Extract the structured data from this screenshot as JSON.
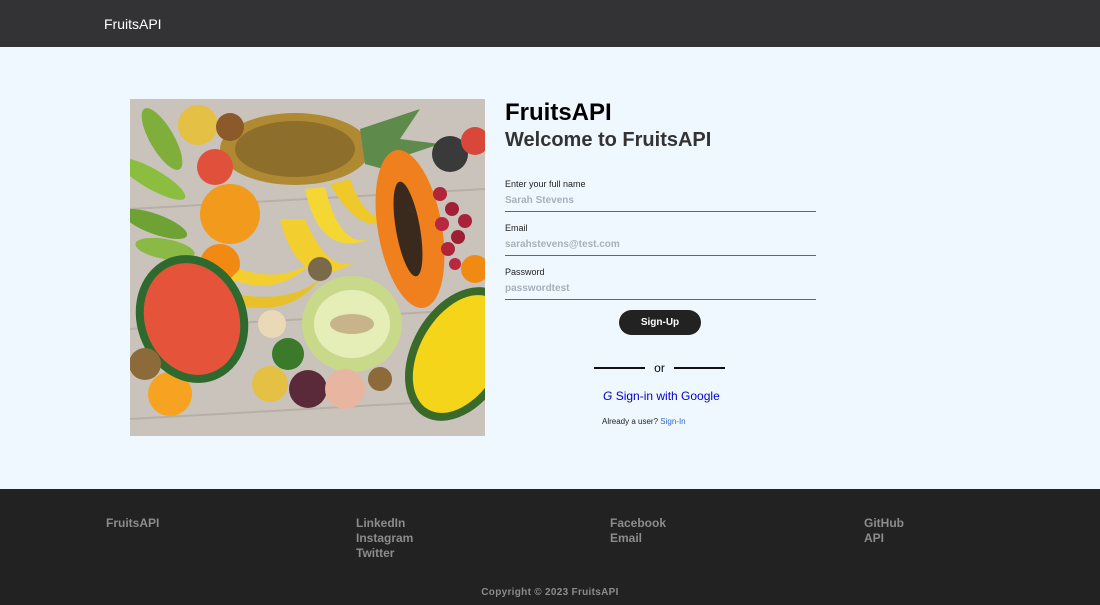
{
  "navbar": {
    "brand": "FruitsAPI"
  },
  "form": {
    "title": "FruitsAPI",
    "subtitle": "Welcome to FruitsAPI",
    "fields": [
      {
        "label": "Enter your full name",
        "value": "",
        "placeholder": "Sarah Stevens"
      },
      {
        "label": "Email",
        "value": "",
        "placeholder": "sarahstevens@test.com"
      },
      {
        "label": "Password",
        "value": "",
        "placeholder": "passwordtest"
      }
    ],
    "signup_label": "Sign-Up",
    "divider_text": "or",
    "google_icon": "G",
    "google_label": "Sign-in with Google",
    "already_user_text": "Already a user?",
    "signin_link": "Sign-In"
  },
  "hero": {
    "icon": "fruits-photo"
  },
  "footer": {
    "columns": [
      {
        "links": [
          "FruitsAPI"
        ]
      },
      {
        "links": [
          "LinkedIn",
          "Instagram",
          "Twitter"
        ]
      },
      {
        "links": [
          "Facebook",
          "Email"
        ]
      },
      {
        "links": [
          "GitHub",
          "API"
        ]
      }
    ],
    "copyright": "Copyright © 2023 FruitsAPI"
  },
  "colors": {
    "navbar_bg": "#333336",
    "page_bg": "#f0f8ff",
    "footer_bg": "#222222",
    "button_bg": "#222222",
    "link": "#0000cc"
  }
}
